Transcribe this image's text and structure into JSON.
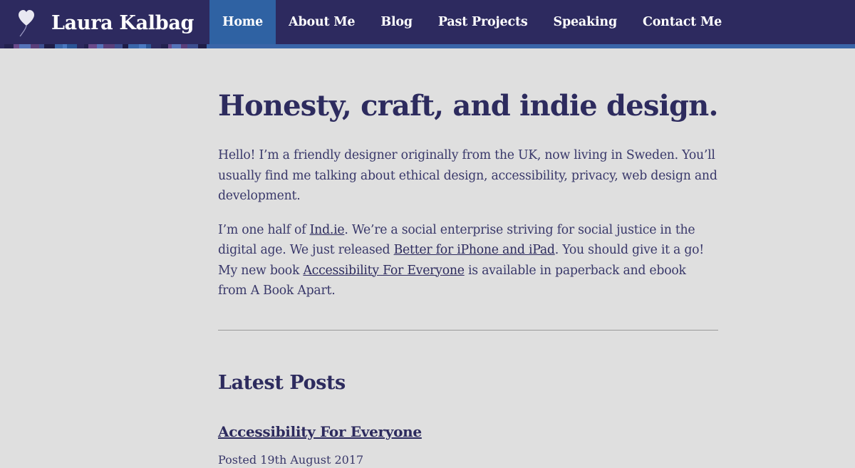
{
  "site": {
    "name": "Laura Kalbag",
    "logo_icon": "heart-balloon-icon"
  },
  "nav": {
    "items": [
      {
        "label": "Home",
        "active": true
      },
      {
        "label": "About Me",
        "active": false
      },
      {
        "label": "Blog",
        "active": false
      },
      {
        "label": "Past Projects",
        "active": false
      },
      {
        "label": "Speaking",
        "active": false
      },
      {
        "label": "Contact Me",
        "active": false
      }
    ]
  },
  "main": {
    "heading": "Honesty, craft, and indie design.",
    "intro": "Hello! I’m a friendly designer originally from the UK, now living in Sweden. You’ll usually find me talking about ethical design, accessibility, privacy, web design and development.",
    "para2": {
      "t1": "I’m one half of ",
      "link1": "Ind.ie",
      "t2": ". We’re a social enterprise striving for social justice in the digital age. We just released ",
      "link2": "Better for iPhone and iPad",
      "t3": ". You should give it a go! My new book ",
      "link3": "Accessibility For Everyone",
      "t4": " is available in paperback and ebook from A Book Apart."
    }
  },
  "latest": {
    "heading": "Latest Posts",
    "posts": [
      {
        "title": "Accessibility For Everyone",
        "meta": "Posted 19th August 2017"
      }
    ]
  },
  "colors": {
    "header_bg": "#2d2a5f",
    "nav_active": "#2f62a3",
    "page_bg": "#dfdfdf",
    "text": "#2d2b5e"
  }
}
